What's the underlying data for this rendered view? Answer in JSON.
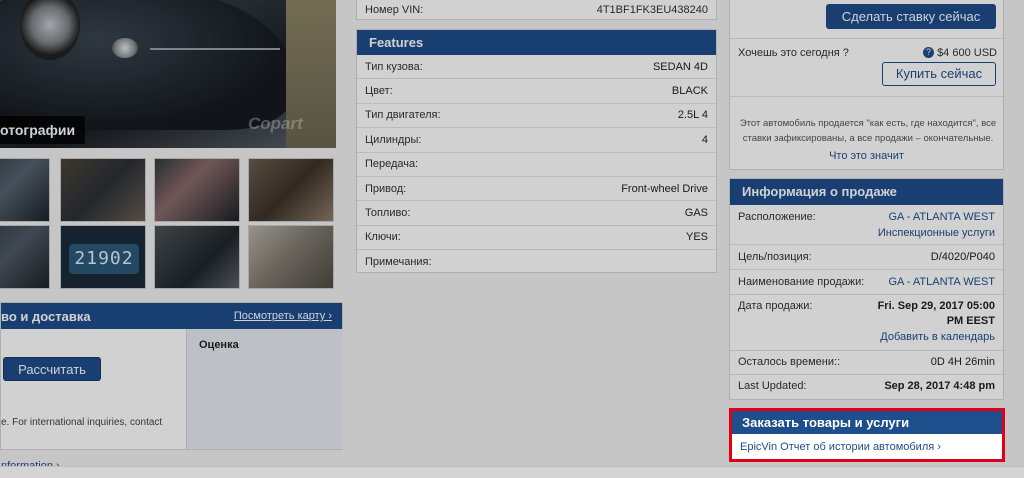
{
  "photos": {
    "label": "отографии",
    "watermark": "Copart",
    "odometer": "21902"
  },
  "shipping": {
    "title": "во и доставка",
    "map_link": "Посмотреть карту ›",
    "calc_button": "Рассчитать",
    "estimate_label": "Оценка",
    "intl_note": "e. For international inquiries, contact",
    "info_link": "nformation ›"
  },
  "vin": {
    "label": "Номер VIN:",
    "value": "4T1BF1FK3EU438240"
  },
  "features": {
    "title": "Features",
    "rows": [
      {
        "label": "Тип кузова:",
        "value": "SEDAN 4D"
      },
      {
        "label": "Цвет:",
        "value": "BLACK"
      },
      {
        "label": "Тип двигателя:",
        "value": "2.5L 4"
      },
      {
        "label": "Цилиндры:",
        "value": "4"
      },
      {
        "label": "Передача:",
        "value": ""
      },
      {
        "label": "Привод:",
        "value": "Front-wheel Drive"
      },
      {
        "label": "Топливо:",
        "value": "GAS"
      },
      {
        "label": "Ключи:",
        "value": "YES"
      },
      {
        "label": "Примечания:",
        "value": ""
      }
    ]
  },
  "bid": {
    "bid_button": "Сделать ставку сейчас",
    "want_today": "Хочешь это сегодня ?",
    "buy_price": "$4 600 USD",
    "buy_button": "Купить сейчас",
    "as_is_note": "Этот автомобиль продается \"как есть, где находится\", все ставки зафиксированы, а все продажи – окончательные.",
    "what_means": "Что это значит"
  },
  "sale_info": {
    "title": "Информация о продаже",
    "location_label": "Расположение:",
    "location_value": "GA - ATLANTA WEST",
    "inspection_link": "Инспекционные услуги",
    "lane_label": "Цель/позиция:",
    "lane_value": "D/4020/P040",
    "sale_name_label": "Наименование продажи:",
    "sale_name_value": "GA - ATLANTA WEST",
    "sale_date_label": "Дата продажи:",
    "sale_date_value": "Fri. Sep 29, 2017 05:00",
    "sale_date_value2": "PM EEST",
    "add_calendar": "Добавить в календарь",
    "time_left_label": "Осталось времени::",
    "time_left_value": "0D 4H 26min",
    "last_updated_label": "Last Updated:",
    "last_updated_value": "Sep 28, 2017 4:48 pm"
  },
  "order": {
    "title": "Заказать товары и услуги",
    "link": "EpicVin Отчет об истории автомобиля ›"
  },
  "colors": {
    "brand_blue": "#1f4e8c",
    "highlight_red": "#e0001a",
    "time_red": "#d22"
  }
}
